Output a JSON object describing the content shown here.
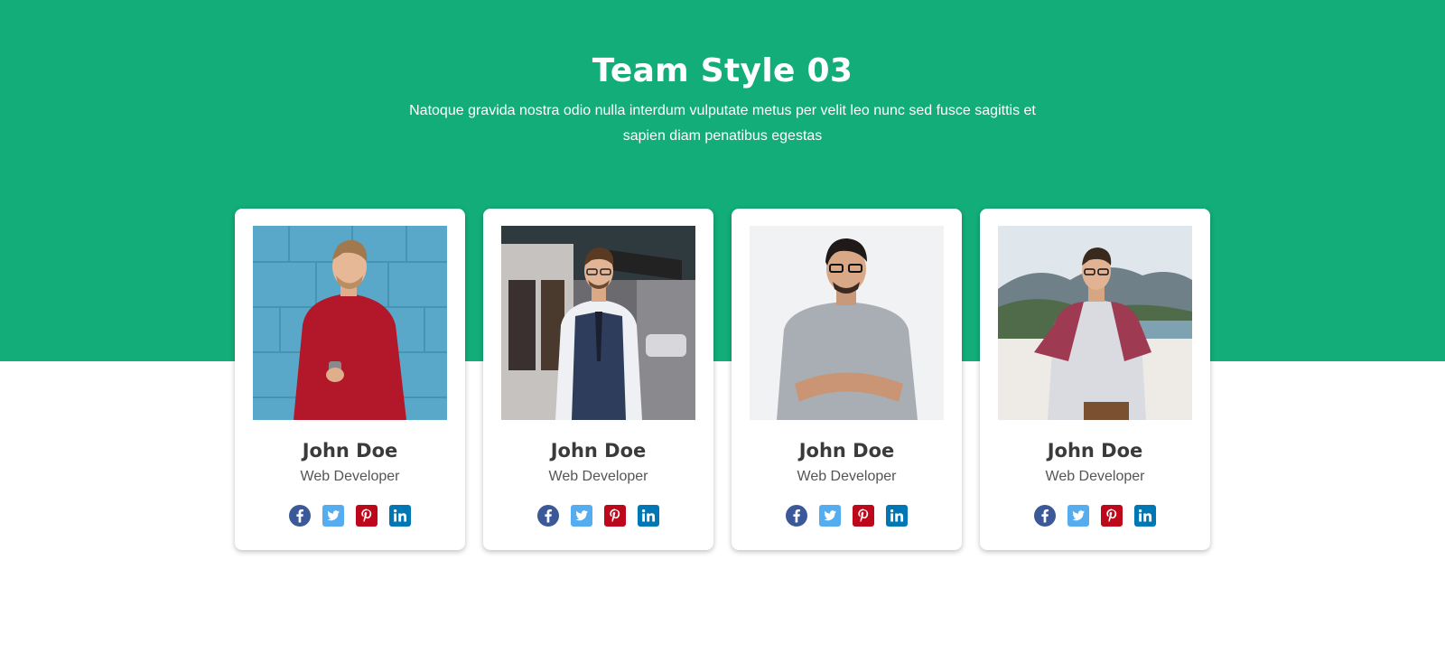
{
  "header": {
    "title": "Team Style 03",
    "subtitle": "Natoque gravida nostra odio nulla interdum vulputate metus per velit leo nunc sed fusce sagittis et sapien diam penatibus egestas"
  },
  "colors": {
    "hero_background": "#13ad7a",
    "facebook": "#3b5998",
    "twitter": "#55acee",
    "pinterest": "#bd081c",
    "linkedin": "#0077b5"
  },
  "team": [
    {
      "name": "John Doe",
      "role": "Web Developer",
      "photo_icon": "person-photo-red-sweater"
    },
    {
      "name": "John Doe",
      "role": "Web Developer",
      "photo_icon": "person-photo-vest-street"
    },
    {
      "name": "John Doe",
      "role": "Web Developer",
      "photo_icon": "person-photo-grey-tshirt"
    },
    {
      "name": "John Doe",
      "role": "Web Developer",
      "photo_icon": "person-photo-raglan-hills"
    }
  ],
  "social_icons": [
    "facebook-icon",
    "twitter-icon",
    "pinterest-icon",
    "linkedin-icon"
  ]
}
